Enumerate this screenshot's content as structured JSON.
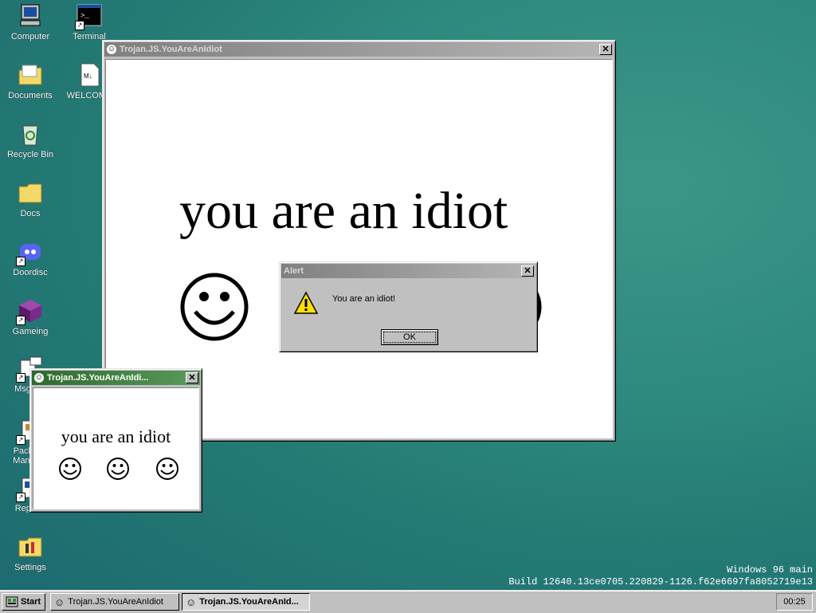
{
  "desktop": {
    "icons": [
      {
        "label": "Computer"
      },
      {
        "label": "Terminal"
      },
      {
        "label": "Documents"
      },
      {
        "label": "WELCOME"
      },
      {
        "label": "Recycle Bin"
      },
      {
        "label": "Docs"
      },
      {
        "label": "Doordisc"
      },
      {
        "label": "Gameing"
      },
      {
        "label": "MsgBox"
      },
      {
        "label": "Package Manager"
      },
      {
        "label": "Reports"
      },
      {
        "label": "Settings"
      }
    ]
  },
  "main_window": {
    "title": "Trojan.JS.YouAreAnIdiot",
    "message": "you are an idiot",
    "close": "✕"
  },
  "small_window": {
    "title": "Trojan.JS.YouAreAnIdi...",
    "message": "you are an idiot",
    "close": "✕"
  },
  "alert": {
    "title": "Alert",
    "message": "You are an idiot!",
    "ok": "OK",
    "close": "✕"
  },
  "taskbar": {
    "start": "Start",
    "tasks": [
      {
        "label": "Trojan.JS.YouAreAnIdiot"
      },
      {
        "label": "Trojan.JS.YouAreAnId..."
      }
    ],
    "clock": "00:25"
  },
  "build_info": {
    "line1": "Windows 96 main",
    "line2": "Build 12640.13ce0705.220829-1126.f62e6697fa8052719e13"
  }
}
